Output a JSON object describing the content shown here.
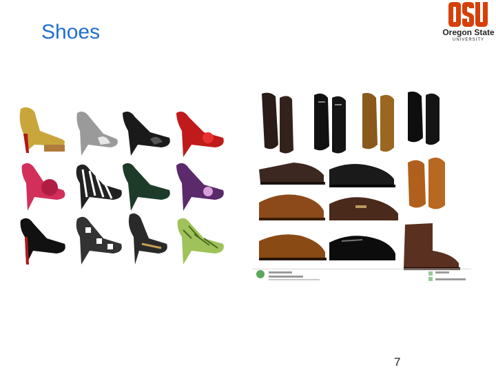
{
  "slide": {
    "title": "Shoes",
    "page_number": "7"
  },
  "logo": {
    "mark": "OSU",
    "line1": "Oregon State",
    "line2": "UNIVERSITY",
    "color": "#d73f09"
  },
  "womens_shoes": {
    "image_name": "womens-heels-collage"
  },
  "mens_shoes": {
    "image_name": "mens-dress-shoes-collage",
    "stock_caption": "Download from Dreamstime.com",
    "stock_id_label": "75595"
  },
  "colors": {
    "title": "#1f6fd1",
    "accent": "#d73f09"
  }
}
